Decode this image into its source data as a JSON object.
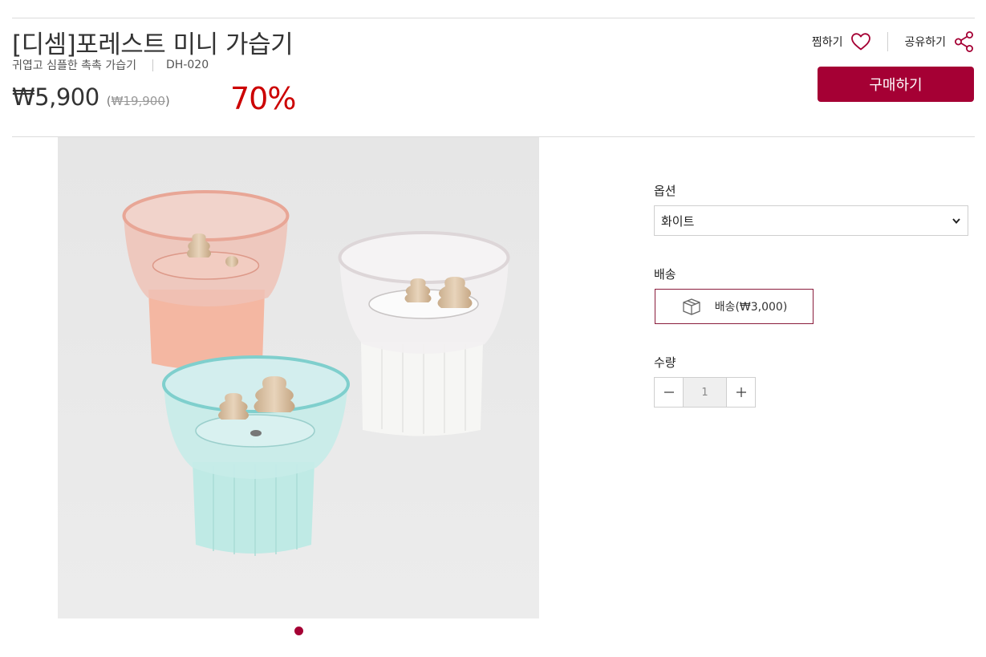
{
  "product": {
    "title": "[디셈]포레스트 미니 가습기",
    "tagline": "귀엽고 심플한 촉촉 가습기",
    "model": "DH-020",
    "price": "₩5,900",
    "original_prefix": "(",
    "original_price": "₩19,900",
    "original_suffix": ")",
    "discount": "70%"
  },
  "actions": {
    "wish_label": "찜하기",
    "share_label": "공유하기",
    "buy_label": "구매하기"
  },
  "options": {
    "option_label": "옵션",
    "option_value": "화이트",
    "shipping_label": "배송",
    "shipping_value": "배송(₩3,000)",
    "quantity_label": "수량",
    "quantity_value": "1"
  },
  "gallery": {
    "current_slide": 1,
    "slide_count": 1
  },
  "colors": {
    "brand": "#a50034",
    "discount": "#cc0000"
  },
  "icons": [
    "heart-icon",
    "share-icon",
    "chevron-down-icon",
    "box-icon",
    "minus-icon",
    "plus-icon"
  ]
}
